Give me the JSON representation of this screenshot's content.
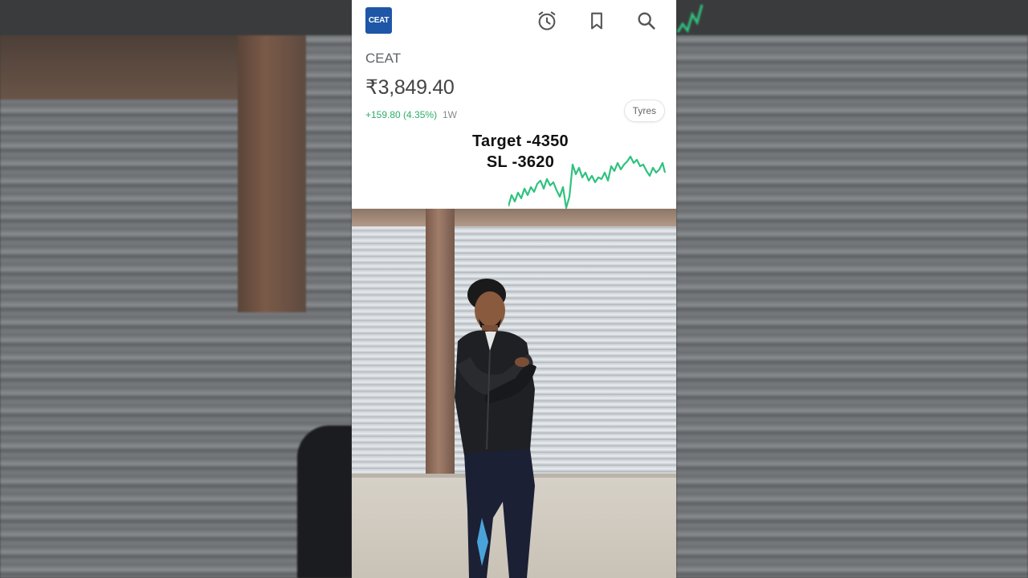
{
  "stock": {
    "logo_text": "CEAT",
    "name": "CEAT",
    "price": "₹3,849.40",
    "change": "+159.80 (4.35%)",
    "period": "1W",
    "sector": "Tyres"
  },
  "header_icons": [
    "alarm-icon",
    "bookmark-icon",
    "search-icon"
  ],
  "overlay": {
    "target": "Target -4350",
    "stoploss": "SL -3620"
  },
  "colors": {
    "logo_bg": "#1e56a8",
    "positive_green": "#2fae6a",
    "sparkline": "#2ec27e"
  }
}
